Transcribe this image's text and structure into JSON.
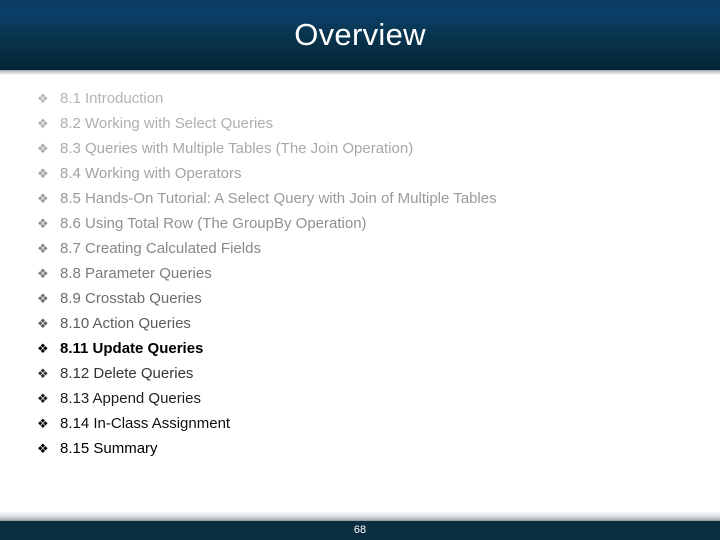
{
  "slide": {
    "title": "Overview",
    "bullet_glyph": "❖",
    "background_color": "#ffffff",
    "header": {
      "gradient_top": "#0a3c63",
      "gradient_bottom": "#042433",
      "title_color": "#ffffff"
    },
    "footer": {
      "background_color": "#0a2e40",
      "page_number": "68",
      "page_number_color": "#ffffff"
    },
    "items": [
      {
        "label": "8.1 Introduction",
        "color": "#b4b4b4",
        "bold": false
      },
      {
        "label": "8.2 Working with Select Queries",
        "color": "#aeaeae",
        "bold": false
      },
      {
        "label": "8.3 Queries with Multiple Tables (The Join Operation)",
        "color": "#a8a8a8",
        "bold": false
      },
      {
        "label": "8.4 Working with Operators",
        "color": "#a2a2a2",
        "bold": false
      },
      {
        "label": "8.5 Hands-On Tutorial: A Select Query with Join of Multiple Tables",
        "color": "#9a9a9a",
        "bold": false
      },
      {
        "label": "8.6 Using Total Row (The GroupBy Operation)",
        "color": "#919191",
        "bold": false
      },
      {
        "label": "8.7 Creating Calculated Fields",
        "color": "#878787",
        "bold": false
      },
      {
        "label": "8.8 Parameter Queries",
        "color": "#7b7b7b",
        "bold": false
      },
      {
        "label": "8.9 Crosstab Queries",
        "color": "#6d6d6d",
        "bold": false
      },
      {
        "label": "8.10 Action Queries",
        "color": "#5c5c5c",
        "bold": false
      },
      {
        "label": "8.11 Update Queries",
        "color": "#000000",
        "bold": true
      },
      {
        "label": "8.12 Delete Queries",
        "color": "#343434",
        "bold": false
      },
      {
        "label": "8.13 Append Queries",
        "color": "#1e1e1e",
        "bold": false
      },
      {
        "label": "8.14 In-Class Assignment",
        "color": "#0f0f0f",
        "bold": false
      },
      {
        "label": "8.15 Summary",
        "color": "#000000",
        "bold": false
      }
    ]
  }
}
